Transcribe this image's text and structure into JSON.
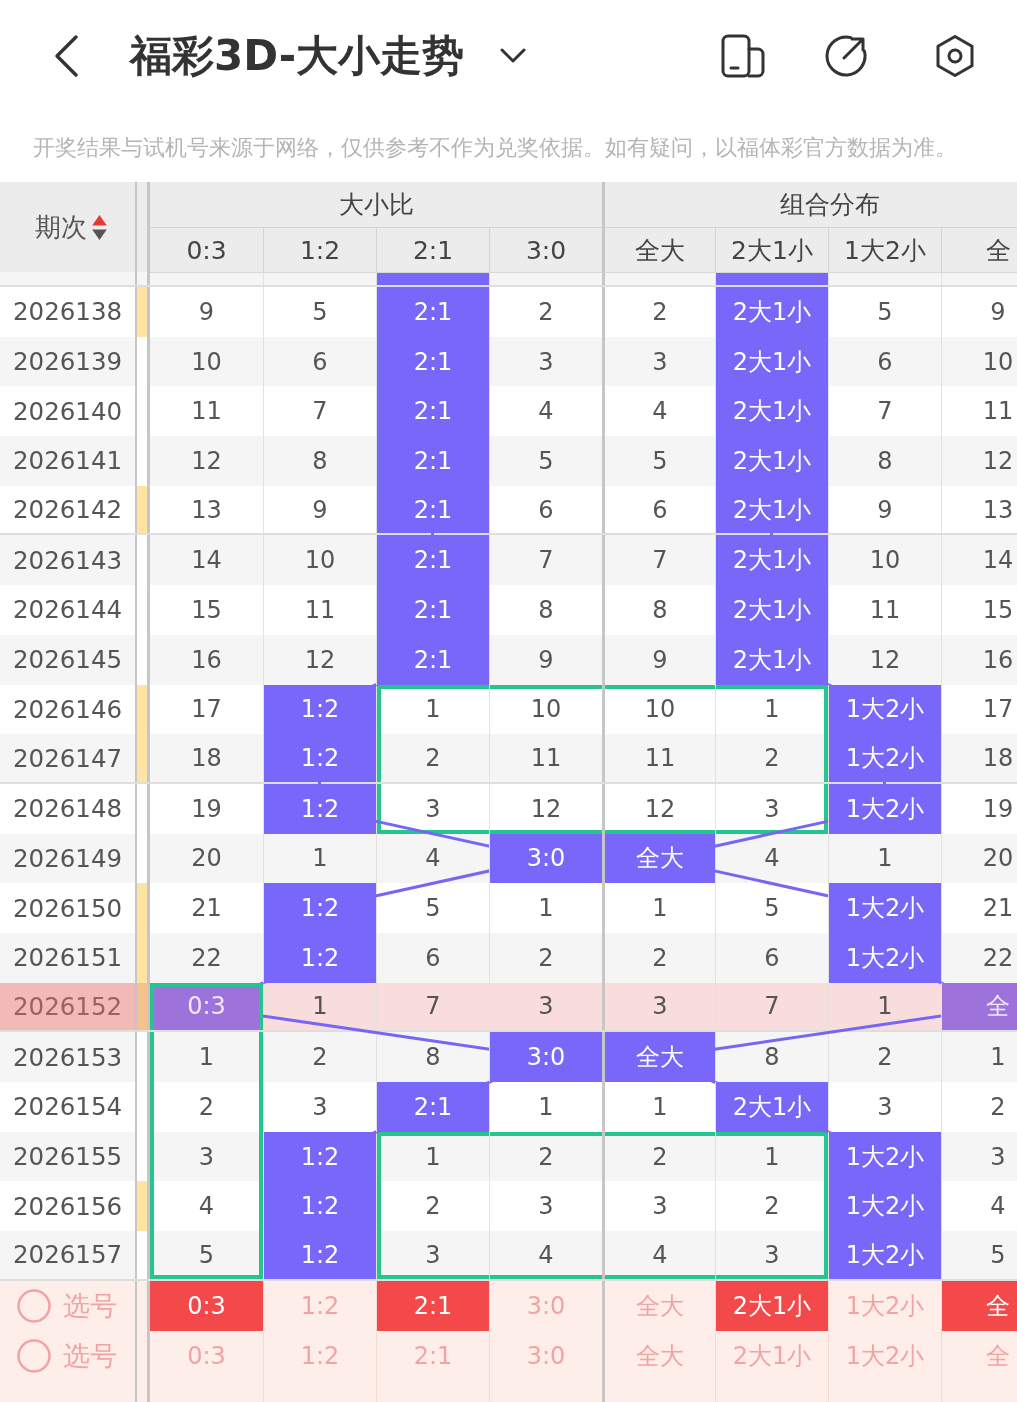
{
  "header": {
    "title": "福彩3D-大小走势",
    "notice": "开奖结果与试机号来源于网络，仅供参考不作为兑奖依据。如有疑问，以福体彩官方数据为准。"
  },
  "table": {
    "period_header": "期次",
    "sort_ascending": true,
    "groups": [
      {
        "title": "大小比",
        "columns": [
          "0:3",
          "1:2",
          "2:1",
          "3:0"
        ]
      },
      {
        "title": "组合分布",
        "columns": [
          "全大",
          "2大1小",
          "1大2小",
          "全"
        ]
      }
    ],
    "partial_row": {
      "cells": [
        {
          "hit": false
        },
        {
          "hit": false
        },
        {
          "hit": true
        },
        {
          "hit": false
        },
        {
          "hit": false
        },
        {
          "hit": true
        },
        {
          "hit": false
        },
        {
          "hit": false
        }
      ]
    },
    "rows": [
      {
        "period": "2026138",
        "marked": true,
        "highlighted": false,
        "cells": [
          {
            "text": "9",
            "hit": false
          },
          {
            "text": "5",
            "hit": false
          },
          {
            "text": "2:1",
            "hit": true
          },
          {
            "text": "2",
            "hit": false
          },
          {
            "text": "2",
            "hit": false
          },
          {
            "text": "2大1小",
            "hit": true
          },
          {
            "text": "5",
            "hit": false
          },
          {
            "text": "9",
            "hit": false
          }
        ]
      },
      {
        "period": "2026139",
        "marked": false,
        "highlighted": false,
        "cells": [
          {
            "text": "10",
            "hit": false
          },
          {
            "text": "6",
            "hit": false
          },
          {
            "text": "2:1",
            "hit": true
          },
          {
            "text": "3",
            "hit": false
          },
          {
            "text": "3",
            "hit": false
          },
          {
            "text": "2大1小",
            "hit": true
          },
          {
            "text": "6",
            "hit": false
          },
          {
            "text": "10",
            "hit": false
          }
        ]
      },
      {
        "period": "2026140",
        "marked": false,
        "highlighted": false,
        "cells": [
          {
            "text": "11",
            "hit": false
          },
          {
            "text": "7",
            "hit": false
          },
          {
            "text": "2:1",
            "hit": true
          },
          {
            "text": "4",
            "hit": false
          },
          {
            "text": "4",
            "hit": false
          },
          {
            "text": "2大1小",
            "hit": true
          },
          {
            "text": "7",
            "hit": false
          },
          {
            "text": "11",
            "hit": false
          }
        ]
      },
      {
        "period": "2026141",
        "marked": false,
        "highlighted": false,
        "cells": [
          {
            "text": "12",
            "hit": false
          },
          {
            "text": "8",
            "hit": false
          },
          {
            "text": "2:1",
            "hit": true
          },
          {
            "text": "5",
            "hit": false
          },
          {
            "text": "5",
            "hit": false
          },
          {
            "text": "2大1小",
            "hit": true
          },
          {
            "text": "8",
            "hit": false
          },
          {
            "text": "12",
            "hit": false
          }
        ]
      },
      {
        "period": "2026142",
        "marked": true,
        "highlighted": false,
        "cells": [
          {
            "text": "13",
            "hit": false
          },
          {
            "text": "9",
            "hit": false
          },
          {
            "text": "2:1",
            "hit": true
          },
          {
            "text": "6",
            "hit": false
          },
          {
            "text": "6",
            "hit": false
          },
          {
            "text": "2大1小",
            "hit": true
          },
          {
            "text": "9",
            "hit": false
          },
          {
            "text": "13",
            "hit": false
          }
        ]
      },
      {
        "period": "2026143",
        "marked": false,
        "highlighted": false,
        "cells": [
          {
            "text": "14",
            "hit": false
          },
          {
            "text": "10",
            "hit": false
          },
          {
            "text": "2:1",
            "hit": true
          },
          {
            "text": "7",
            "hit": false
          },
          {
            "text": "7",
            "hit": false
          },
          {
            "text": "2大1小",
            "hit": true
          },
          {
            "text": "10",
            "hit": false
          },
          {
            "text": "14",
            "hit": false
          }
        ]
      },
      {
        "period": "2026144",
        "marked": false,
        "highlighted": false,
        "cells": [
          {
            "text": "15",
            "hit": false
          },
          {
            "text": "11",
            "hit": false
          },
          {
            "text": "2:1",
            "hit": true
          },
          {
            "text": "8",
            "hit": false
          },
          {
            "text": "8",
            "hit": false
          },
          {
            "text": "2大1小",
            "hit": true
          },
          {
            "text": "11",
            "hit": false
          },
          {
            "text": "15",
            "hit": false
          }
        ]
      },
      {
        "period": "2026145",
        "marked": false,
        "highlighted": false,
        "cells": [
          {
            "text": "16",
            "hit": false
          },
          {
            "text": "12",
            "hit": false
          },
          {
            "text": "2:1",
            "hit": true
          },
          {
            "text": "9",
            "hit": false
          },
          {
            "text": "9",
            "hit": false
          },
          {
            "text": "2大1小",
            "hit": true
          },
          {
            "text": "12",
            "hit": false
          },
          {
            "text": "16",
            "hit": false
          }
        ]
      },
      {
        "period": "2026146",
        "marked": true,
        "highlighted": false,
        "cells": [
          {
            "text": "17",
            "hit": false
          },
          {
            "text": "1:2",
            "hit": true
          },
          {
            "text": "1",
            "hit": false,
            "box": {
              "top": true,
              "right": false,
              "bottom": false,
              "left": true
            }
          },
          {
            "text": "10",
            "hit": false,
            "box": {
              "top": true,
              "right": false,
              "bottom": false,
              "left": false
            }
          },
          {
            "text": "10",
            "hit": false,
            "box": {
              "top": true,
              "right": false,
              "bottom": false,
              "left": false
            }
          },
          {
            "text": "1",
            "hit": false,
            "box": {
              "top": true,
              "right": true,
              "bottom": false,
              "left": false
            }
          },
          {
            "text": "1大2小",
            "hit": true
          },
          {
            "text": "17",
            "hit": false
          }
        ]
      },
      {
        "period": "2026147",
        "marked": true,
        "highlighted": false,
        "cells": [
          {
            "text": "18",
            "hit": false
          },
          {
            "text": "1:2",
            "hit": true
          },
          {
            "text": "2",
            "hit": false,
            "box": {
              "top": false,
              "right": false,
              "bottom": false,
              "left": true
            }
          },
          {
            "text": "11",
            "hit": false
          },
          {
            "text": "11",
            "hit": false
          },
          {
            "text": "2",
            "hit": false,
            "box": {
              "top": false,
              "right": true,
              "bottom": false,
              "left": false
            }
          },
          {
            "text": "1大2小",
            "hit": true
          },
          {
            "text": "18",
            "hit": false
          }
        ]
      },
      {
        "period": "2026148",
        "marked": false,
        "highlighted": false,
        "cells": [
          {
            "text": "19",
            "hit": false
          },
          {
            "text": "1:2",
            "hit": true
          },
          {
            "text": "3",
            "hit": false,
            "box": {
              "top": false,
              "right": false,
              "bottom": true,
              "left": true
            }
          },
          {
            "text": "12",
            "hit": false,
            "box": {
              "top": false,
              "right": false,
              "bottom": true,
              "left": false
            }
          },
          {
            "text": "12",
            "hit": false,
            "box": {
              "top": false,
              "right": false,
              "bottom": true,
              "left": false
            }
          },
          {
            "text": "3",
            "hit": false,
            "box": {
              "top": false,
              "right": true,
              "bottom": true,
              "left": false
            }
          },
          {
            "text": "1大2小",
            "hit": true
          },
          {
            "text": "19",
            "hit": false
          }
        ]
      },
      {
        "period": "2026149",
        "marked": false,
        "highlighted": false,
        "cells": [
          {
            "text": "20",
            "hit": false
          },
          {
            "text": "1",
            "hit": false
          },
          {
            "text": "4",
            "hit": false
          },
          {
            "text": "3:0",
            "hit": true
          },
          {
            "text": "全大",
            "hit": true
          },
          {
            "text": "4",
            "hit": false
          },
          {
            "text": "1",
            "hit": false
          },
          {
            "text": "20",
            "hit": false
          }
        ]
      },
      {
        "period": "2026150",
        "marked": true,
        "highlighted": false,
        "cells": [
          {
            "text": "21",
            "hit": false
          },
          {
            "text": "1:2",
            "hit": true
          },
          {
            "text": "5",
            "hit": false
          },
          {
            "text": "1",
            "hit": false
          },
          {
            "text": "1",
            "hit": false
          },
          {
            "text": "5",
            "hit": false
          },
          {
            "text": "1大2小",
            "hit": true
          },
          {
            "text": "21",
            "hit": false
          }
        ]
      },
      {
        "period": "2026151",
        "marked": true,
        "highlighted": false,
        "cells": [
          {
            "text": "22",
            "hit": false
          },
          {
            "text": "1:2",
            "hit": true
          },
          {
            "text": "6",
            "hit": false
          },
          {
            "text": "2",
            "hit": false
          },
          {
            "text": "2",
            "hit": false
          },
          {
            "text": "6",
            "hit": false
          },
          {
            "text": "1大2小",
            "hit": true
          },
          {
            "text": "22",
            "hit": false
          }
        ]
      },
      {
        "period": "2026152",
        "marked": true,
        "highlighted": true,
        "cells": [
          {
            "text": "0:3",
            "hit": true,
            "box": {
              "top": true,
              "right": true,
              "bottom": false,
              "left": true
            }
          },
          {
            "text": "1",
            "hit": false
          },
          {
            "text": "7",
            "hit": false
          },
          {
            "text": "3",
            "hit": false
          },
          {
            "text": "3",
            "hit": false
          },
          {
            "text": "7",
            "hit": false
          },
          {
            "text": "1",
            "hit": false
          },
          {
            "text": "全",
            "hit": true
          }
        ]
      },
      {
        "period": "2026153",
        "marked": false,
        "highlighted": false,
        "cells": [
          {
            "text": "1",
            "hit": false,
            "box": {
              "top": false,
              "right": true,
              "bottom": false,
              "left": true
            }
          },
          {
            "text": "2",
            "hit": false
          },
          {
            "text": "8",
            "hit": false
          },
          {
            "text": "3:0",
            "hit": true
          },
          {
            "text": "全大",
            "hit": true
          },
          {
            "text": "8",
            "hit": false
          },
          {
            "text": "2",
            "hit": false
          },
          {
            "text": "1",
            "hit": false
          }
        ]
      },
      {
        "period": "2026154",
        "marked": false,
        "highlighted": false,
        "cells": [
          {
            "text": "2",
            "hit": false,
            "box": {
              "top": false,
              "right": true,
              "bottom": false,
              "left": true
            }
          },
          {
            "text": "3",
            "hit": false
          },
          {
            "text": "2:1",
            "hit": true
          },
          {
            "text": "1",
            "hit": false
          },
          {
            "text": "1",
            "hit": false
          },
          {
            "text": "2大1小",
            "hit": true
          },
          {
            "text": "3",
            "hit": false
          },
          {
            "text": "2",
            "hit": false
          }
        ]
      },
      {
        "period": "2026155",
        "marked": false,
        "highlighted": false,
        "cells": [
          {
            "text": "3",
            "hit": false,
            "box": {
              "top": false,
              "right": true,
              "bottom": false,
              "left": true
            }
          },
          {
            "text": "1:2",
            "hit": true
          },
          {
            "text": "1",
            "hit": false,
            "box": {
              "top": true,
              "right": false,
              "bottom": false,
              "left": true
            }
          },
          {
            "text": "2",
            "hit": false,
            "box": {
              "top": true,
              "right": false,
              "bottom": false,
              "left": false
            }
          },
          {
            "text": "2",
            "hit": false,
            "box": {
              "top": true,
              "right": false,
              "bottom": false,
              "left": false
            }
          },
          {
            "text": "1",
            "hit": false,
            "box": {
              "top": true,
              "right": true,
              "bottom": false,
              "left": false
            }
          },
          {
            "text": "1大2小",
            "hit": true
          },
          {
            "text": "3",
            "hit": false
          }
        ]
      },
      {
        "period": "2026156",
        "marked": true,
        "highlighted": false,
        "cells": [
          {
            "text": "4",
            "hit": false,
            "box": {
              "top": false,
              "right": true,
              "bottom": false,
              "left": true
            }
          },
          {
            "text": "1:2",
            "hit": true
          },
          {
            "text": "2",
            "hit": false,
            "box": {
              "top": false,
              "right": false,
              "bottom": false,
              "left": true
            }
          },
          {
            "text": "3",
            "hit": false
          },
          {
            "text": "3",
            "hit": false
          },
          {
            "text": "2",
            "hit": false,
            "box": {
              "top": false,
              "right": true,
              "bottom": false,
              "left": false
            }
          },
          {
            "text": "1大2小",
            "hit": true
          },
          {
            "text": "4",
            "hit": false
          }
        ]
      },
      {
        "period": "2026157",
        "marked": false,
        "highlighted": false,
        "cells": [
          {
            "text": "5",
            "hit": false,
            "box": {
              "top": false,
              "right": true,
              "bottom": true,
              "left": true
            }
          },
          {
            "text": "1:2",
            "hit": true
          },
          {
            "text": "3",
            "hit": false,
            "box": {
              "top": false,
              "right": false,
              "bottom": true,
              "left": true
            }
          },
          {
            "text": "4",
            "hit": false,
            "box": {
              "top": false,
              "right": false,
              "bottom": true,
              "left": false
            }
          },
          {
            "text": "4",
            "hit": false,
            "box": {
              "top": false,
              "right": false,
              "bottom": true,
              "left": false
            }
          },
          {
            "text": "3",
            "hit": false,
            "box": {
              "top": false,
              "right": true,
              "bottom": true,
              "left": false
            }
          },
          {
            "text": "1大2小",
            "hit": true
          },
          {
            "text": "5",
            "hit": false
          }
        ]
      }
    ],
    "pick_rows": [
      {
        "label": "选号",
        "checked": false,
        "cells": [
          {
            "text": "0:3",
            "selected": true
          },
          {
            "text": "1:2",
            "selected": false
          },
          {
            "text": "2:1",
            "selected": true
          },
          {
            "text": "3:0",
            "selected": false
          },
          {
            "text": "全大",
            "selected": false
          },
          {
            "text": "2大1小",
            "selected": true
          },
          {
            "text": "1大2小",
            "selected": false
          },
          {
            "text": "全",
            "selected": true
          }
        ]
      },
      {
        "label": "选号",
        "checked": false,
        "cells": [
          {
            "text": "0:3",
            "selected": false
          },
          {
            "text": "1:2",
            "selected": false
          },
          {
            "text": "2:1",
            "selected": false
          },
          {
            "text": "3:0",
            "selected": false
          },
          {
            "text": "全大",
            "selected": false
          },
          {
            "text": "2大1小",
            "selected": false
          },
          {
            "text": "1大2小",
            "selected": false
          },
          {
            "text": "全",
            "selected": false
          }
        ]
      }
    ]
  }
}
